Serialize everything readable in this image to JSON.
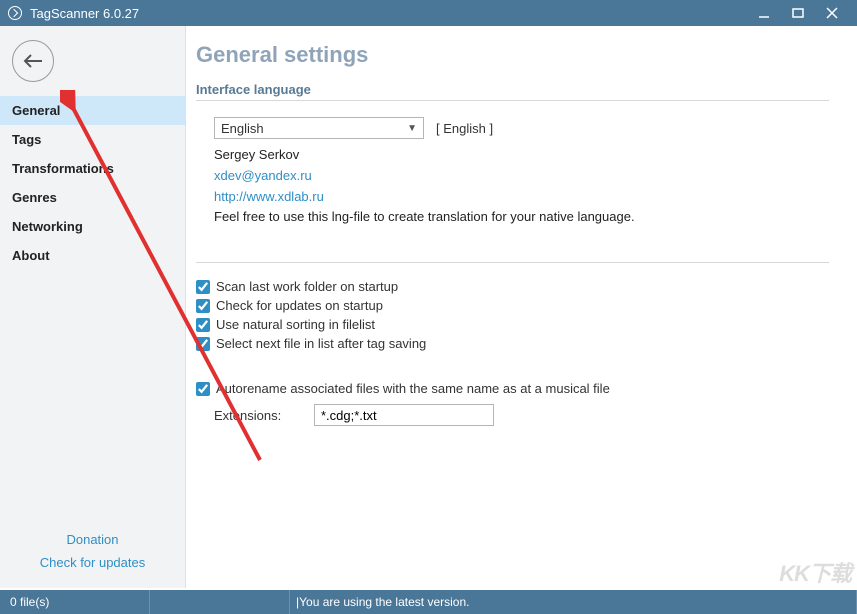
{
  "titlebar": {
    "title": "TagScanner 6.0.27"
  },
  "sidebar": {
    "items": [
      {
        "label": "General",
        "active": true
      },
      {
        "label": "Tags",
        "active": false
      },
      {
        "label": "Transformations",
        "active": false
      },
      {
        "label": "Genres",
        "active": false
      },
      {
        "label": "Networking",
        "active": false
      },
      {
        "label": "About",
        "active": false
      }
    ],
    "donation": "Donation",
    "check_updates": "Check for updates"
  },
  "main": {
    "heading": "General settings",
    "section_interface": "Interface language",
    "language_select": "English",
    "language_bracket": "[ English ]",
    "author": "Sergey Serkov",
    "email": "xdev@yandex.ru",
    "website": "http://www.xdlab.ru",
    "lng_note": "Feel free to use this lng-file to create translation for your native language.",
    "checks": {
      "scan_last": "Scan last work folder on startup",
      "check_updates": "Check for updates on startup",
      "natural_sort": "Use natural sorting in filelist",
      "select_next": "Select next file in list after tag saving",
      "autorename": "Autorename associated files with the same name as at a musical file"
    },
    "ext_label": "Extensions:",
    "ext_value": "*.cdg;*.txt"
  },
  "statusbar": {
    "files": "0 file(s)",
    "version_msg": "You are using the latest version."
  },
  "watermark": "KK下载"
}
